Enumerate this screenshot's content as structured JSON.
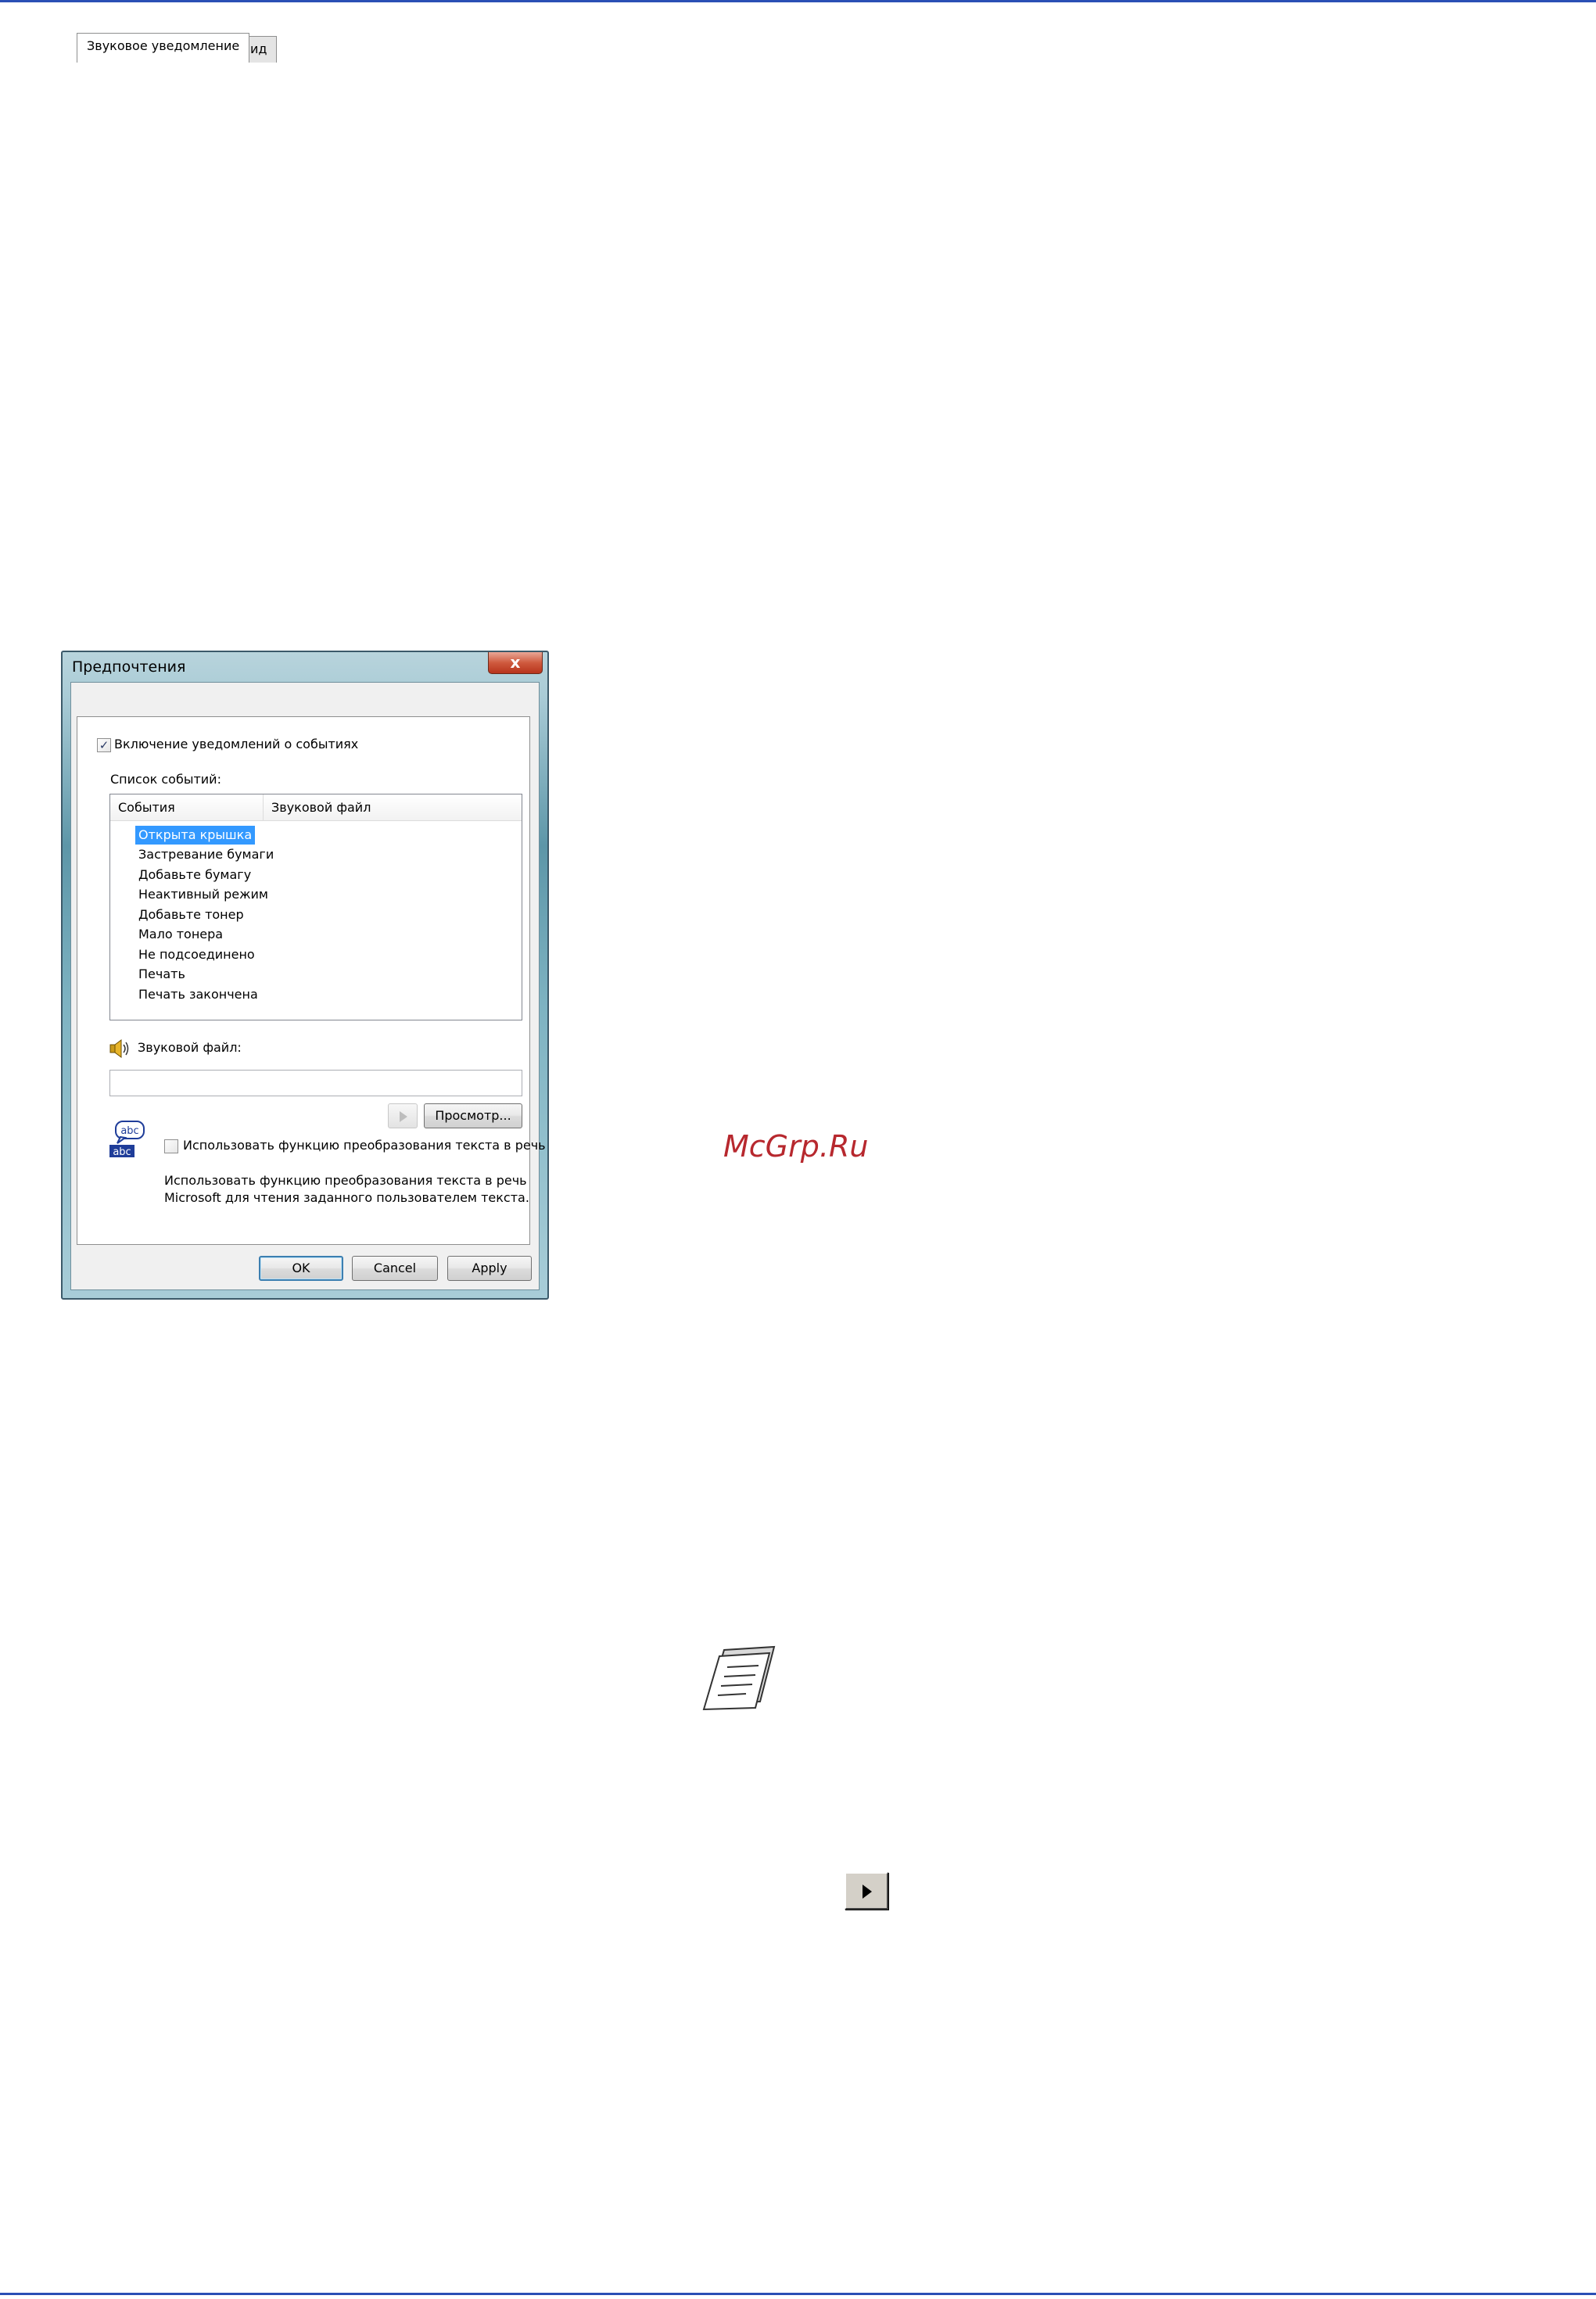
{
  "dialog": {
    "title": "Предпочтения",
    "close_glyph": "x",
    "tabs": [
      {
        "label": "Звуковое уведомление",
        "active": true
      },
      {
        "label": "Вид",
        "active": false
      }
    ],
    "enable_checkbox": {
      "label": "Включение уведомлений о событиях",
      "checked": true,
      "check_glyph": "✓"
    },
    "event_list_label": "Список событий:",
    "columns": [
      "События",
      "Звуковой файл"
    ],
    "events": [
      "Открыта крышка",
      "Застревание бумаги",
      "Добавьте бумагу",
      "Неактивный режим",
      "Добавьте тонер",
      "Мало тонера",
      "Не подсоединено",
      "Печать",
      "Печать закончена"
    ],
    "selected_event_index": 0,
    "sound_file_label": "Звуковой файл:",
    "sound_file_value": "",
    "browse_button": "Просмотр...",
    "tts_icon_top": "abc",
    "tts_icon_bottom": "abc",
    "tts_checkbox": {
      "label": "Использовать функцию преобразования текста в речь",
      "checked": false
    },
    "tts_description": [
      "Использовать функцию преобразования текста в речь",
      "Microsoft для чтения заданного пользователем текста."
    ],
    "buttons": {
      "ok": "OK",
      "cancel": "Cancel",
      "apply": "Apply"
    }
  },
  "watermark": "McGrp.Ru",
  "colors": {
    "rule": "#2a4fb5",
    "selection": "#3399ff",
    "watermark": "#b7282e"
  }
}
